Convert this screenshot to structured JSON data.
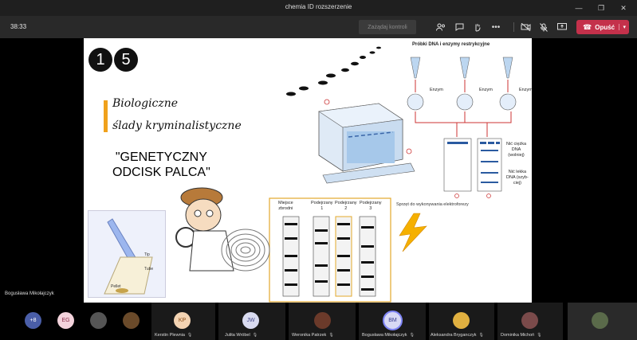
{
  "window": {
    "title": "chemia ID rozszerzenie",
    "minimize": "—",
    "maximize": "❐",
    "close": "✕"
  },
  "toolbar": {
    "timer": "38:33",
    "hand_button": "Zażądaj kontroli",
    "leave_label": "Opuść",
    "accent": "#c4314b"
  },
  "presenter": "Bogusława Mikołajczyk",
  "slide": {
    "num1": "1",
    "num2": "5",
    "title_line1": "Biologiczne",
    "title_line2": "ślady kryminalistyczne",
    "headline_line1": "\"GENETYCZNY",
    "headline_line2": "ODCISK PALCA\"",
    "dna_caption": "Próbki DNA i enzymy restrykcyjne",
    "enzym": "Enzym",
    "heavy_strand": [
      "Nić ciężka",
      "DNA",
      "(wolniej)"
    ],
    "light_strand": [
      "Nić lekka",
      "DNA (szyb-",
      "ciej)"
    ],
    "gel_caption": "Sprzęt do wykonywania elektroforezy",
    "lanes": [
      {
        "line1": "Miejsce",
        "line2": "zbrodni"
      },
      {
        "line1": "Podejrzany",
        "line2": "1"
      },
      {
        "line1": "Podejrzany",
        "line2": "2"
      },
      {
        "line1": "Podejrzany",
        "line2": "3"
      }
    ],
    "pipette_labels": {
      "tip": "Tip",
      "tube": "Tube",
      "pellet": "Pellet"
    },
    "accent": "#f0a11c"
  },
  "participants": {
    "overflow": "+8",
    "eg": "EG",
    "people": [
      {
        "initials": "KP",
        "name": "Kerstin Plewnia",
        "color": "#f3d3b2",
        "text": "#8a4b12"
      },
      {
        "initials": "JW",
        "name": "Julita Wróbel",
        "color": "#d9dbf0",
        "text": "#454a8a"
      },
      {
        "initials": "",
        "name": "Weronika Patrzek",
        "color": "#6b3a2a",
        "text": "#fff"
      },
      {
        "initials": "BM",
        "name": "Bogusława Mikołajczyk",
        "color": "#d8d9f4",
        "text": "#383d8f"
      },
      {
        "initials": "",
        "name": "Aleksandra Bryganczyk",
        "color": "#e0b040",
        "text": "#fff"
      },
      {
        "initials": "",
        "name": "Dominika Michoń",
        "color": "#7a4a4a",
        "text": "#fff"
      }
    ]
  }
}
